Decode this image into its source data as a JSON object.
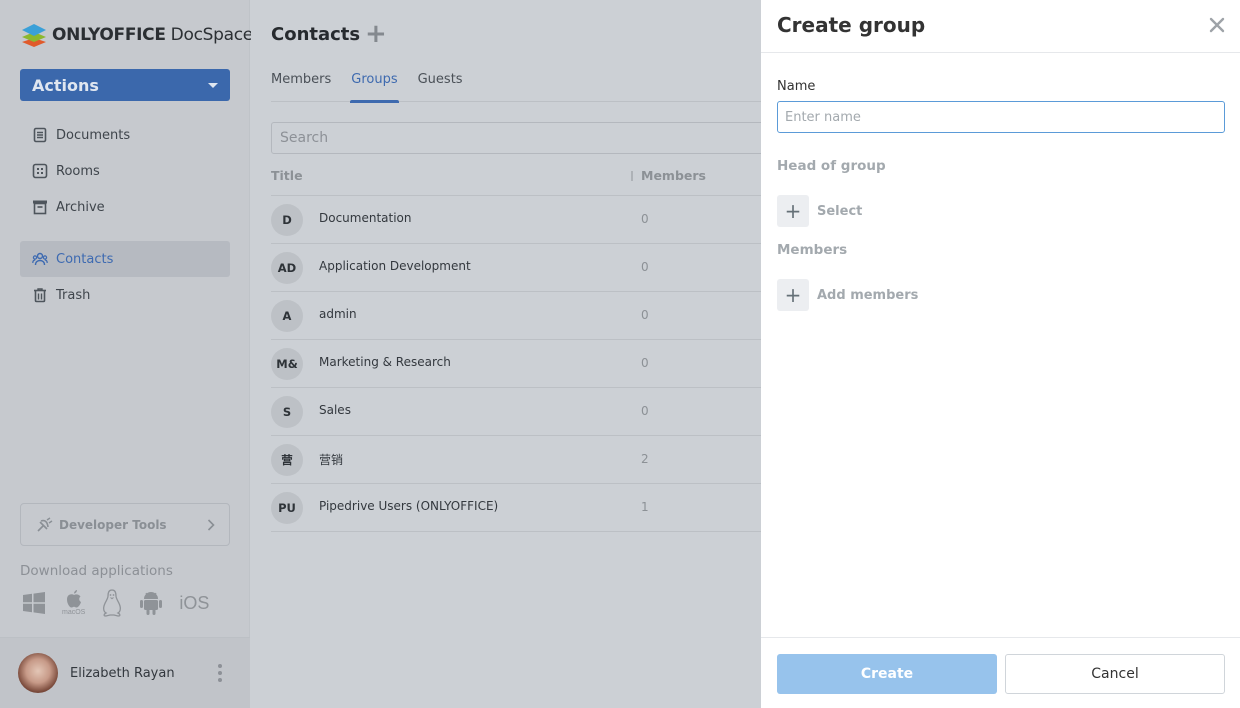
{
  "app": {
    "logo_bold": "ONLYOFFICE",
    "logo_light": "DocSpace"
  },
  "sidebar": {
    "actions_label": "Actions",
    "items": [
      {
        "label": "Documents",
        "icon": "document-icon",
        "active": false
      },
      {
        "label": "Rooms",
        "icon": "rooms-icon",
        "active": false
      },
      {
        "label": "Archive",
        "icon": "archive-icon",
        "active": false
      },
      {
        "label": "Contacts",
        "icon": "contacts-icon",
        "active": true
      },
      {
        "label": "Trash",
        "icon": "trash-icon",
        "active": false
      }
    ],
    "developer_tools_label": "Developer Tools",
    "download_title": "Download applications",
    "download_apps": [
      "windows",
      "macOS",
      "linux",
      "android",
      "iOS"
    ],
    "macos_label": "macOS",
    "ios_label": "iOS",
    "profile_name": "Elizabeth Rayan"
  },
  "main": {
    "title": "Contacts",
    "tabs": [
      {
        "label": "Members",
        "active": false
      },
      {
        "label": "Groups",
        "active": true
      },
      {
        "label": "Guests",
        "active": false
      }
    ],
    "search_placeholder": "Search",
    "columns": {
      "title": "Title",
      "members": "Members"
    },
    "groups": [
      {
        "initials": "D",
        "name": "Documentation",
        "members": "0"
      },
      {
        "initials": "AD",
        "name": "Application Development",
        "members": "0"
      },
      {
        "initials": "A",
        "name": "admin",
        "members": "0"
      },
      {
        "initials": "M&",
        "name": "Marketing & Research",
        "members": "0"
      },
      {
        "initials": "S",
        "name": "Sales",
        "members": "0"
      },
      {
        "initials": "营",
        "name": "营销",
        "members": "2"
      },
      {
        "initials": "PU",
        "name": "Pipedrive Users (ONLYOFFICE)",
        "members": "1"
      }
    ]
  },
  "panel": {
    "title": "Create group",
    "name_label": "Name",
    "name_placeholder": "Enter name",
    "name_value": "",
    "head_label": "Head of group",
    "head_select_label": "Select",
    "members_label": "Members",
    "add_members_label": "Add members",
    "create_label": "Create",
    "cancel_label": "Cancel"
  },
  "colors": {
    "accent": "#3e6aaf",
    "actions_button": "#3b68ac",
    "create_disabled": "#97c3ec",
    "input_focus": "#5b9bd8"
  }
}
